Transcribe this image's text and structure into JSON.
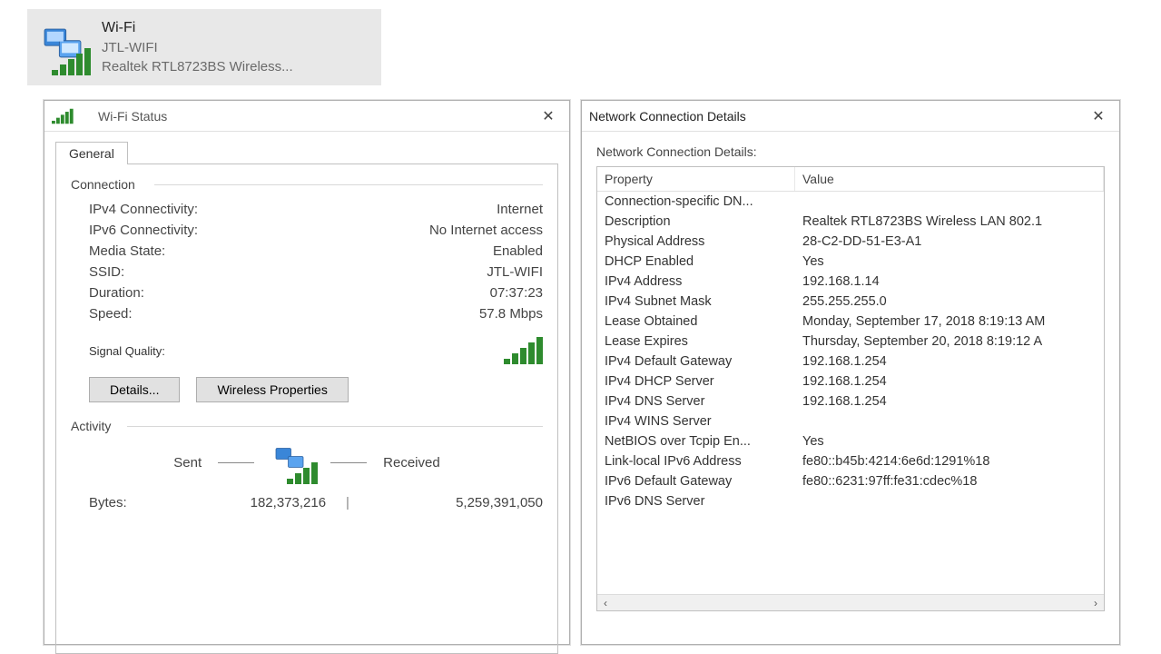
{
  "adapter": {
    "name": "Wi-Fi",
    "ssid": "JTL-WIFI",
    "description": "Realtek RTL8723BS Wireless..."
  },
  "wifi_status": {
    "title": "Wi-Fi Status",
    "tab_general": "General",
    "group_connection": "Connection",
    "rows": {
      "ipv4_conn": {
        "k": "IPv4 Connectivity:",
        "v": "Internet"
      },
      "ipv6_conn": {
        "k": "IPv6 Connectivity:",
        "v": "No Internet access"
      },
      "media": {
        "k": "Media State:",
        "v": "Enabled"
      },
      "ssid": {
        "k": "SSID:",
        "v": "JTL-WIFI"
      },
      "duration": {
        "k": "Duration:",
        "v": "07:37:23"
      },
      "speed": {
        "k": "Speed:",
        "v": "57.8 Mbps"
      }
    },
    "signal_quality_label": "Signal Quality:",
    "btn_details": "Details...",
    "btn_wireless_props": "Wireless Properties",
    "group_activity": "Activity",
    "activity_sent": "Sent",
    "activity_received": "Received",
    "bytes_label": "Bytes:",
    "bytes_sent": "182,373,216",
    "bytes_received": "5,259,391,050"
  },
  "net_details": {
    "title": "Network Connection Details",
    "body_label": "Network Connection Details:",
    "col_property": "Property",
    "col_value": "Value",
    "rows": [
      {
        "p": "Connection-specific DN...",
        "v": ""
      },
      {
        "p": "Description",
        "v": "Realtek RTL8723BS Wireless LAN 802.1"
      },
      {
        "p": "Physical Address",
        "v": "28-C2-DD-51-E3-A1"
      },
      {
        "p": "DHCP Enabled",
        "v": "Yes"
      },
      {
        "p": "IPv4 Address",
        "v": "192.168.1.14"
      },
      {
        "p": "IPv4 Subnet Mask",
        "v": "255.255.255.0"
      },
      {
        "p": "Lease Obtained",
        "v": "Monday, September 17, 2018 8:19:13 AM"
      },
      {
        "p": "Lease Expires",
        "v": "Thursday, September 20, 2018 8:19:12 A"
      },
      {
        "p": "IPv4 Default Gateway",
        "v": "192.168.1.254"
      },
      {
        "p": "IPv4 DHCP Server",
        "v": "192.168.1.254"
      },
      {
        "p": "IPv4 DNS Server",
        "v": "192.168.1.254"
      },
      {
        "p": "IPv4 WINS Server",
        "v": ""
      },
      {
        "p": "NetBIOS over Tcpip En...",
        "v": "Yes"
      },
      {
        "p": "Link-local IPv6 Address",
        "v": "fe80::b45b:4214:6e6d:1291%18"
      },
      {
        "p": "IPv6 Default Gateway",
        "v": "fe80::6231:97ff:fe31:cdec%18"
      },
      {
        "p": "IPv6 DNS Server",
        "v": ""
      }
    ]
  }
}
